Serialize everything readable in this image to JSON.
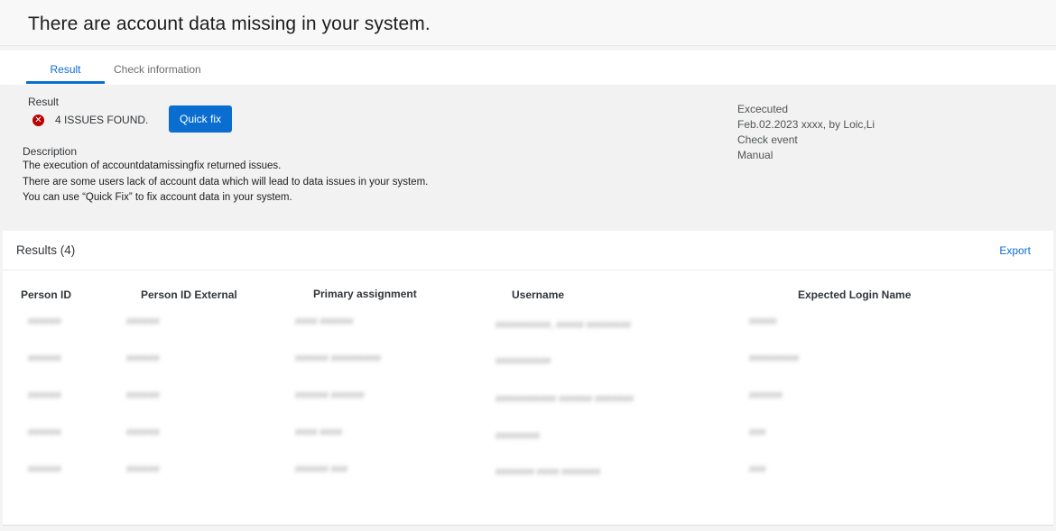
{
  "header": {
    "title": "There are account data missing in your system."
  },
  "tabs": [
    {
      "label": "Result",
      "selected": true
    },
    {
      "label": "Check information",
      "selected": false
    }
  ],
  "summary": {
    "result_label": "Result",
    "issues_text": "4 ISSUES FOUND.",
    "status_icon": "error-circle-icon",
    "quick_fix_label": "Quick fix",
    "description_label": "Description",
    "description_lines": [
      "The execution of accountdatamissingfix returned issues.",
      "There are some users lack of account data which will lead to data issues in your system.",
      "You can use “Quick Fix” to fix account data in your system."
    ],
    "execution": {
      "executed_label": "Excecuted",
      "executed_value": "Feb.02.2023 xxxx, by Loic,Li",
      "event_label": "Check event",
      "event_value": "Manual"
    }
  },
  "results": {
    "title": "Results (4)",
    "export_label": "Export",
    "columns": [
      "Person ID",
      "Person ID External",
      "Primary assignment",
      "Username",
      "Expected Login Name"
    ],
    "rows": [
      [
        "######",
        "######",
        "#### ######",
        "##########, ##### ########",
        "#####"
      ],
      [
        "######",
        "######",
        "###### #########",
        "##########",
        "#########"
      ],
      [
        "######",
        "######",
        "###### ######",
        "########### ###### #######",
        "######"
      ],
      [
        "######",
        "######",
        "#### ####",
        "########",
        "###"
      ],
      [
        "######",
        "######",
        "###### ###",
        "####### #### #######",
        "###"
      ]
    ]
  },
  "colors": {
    "accent": "#0a6ed1",
    "error": "#bb0000"
  }
}
